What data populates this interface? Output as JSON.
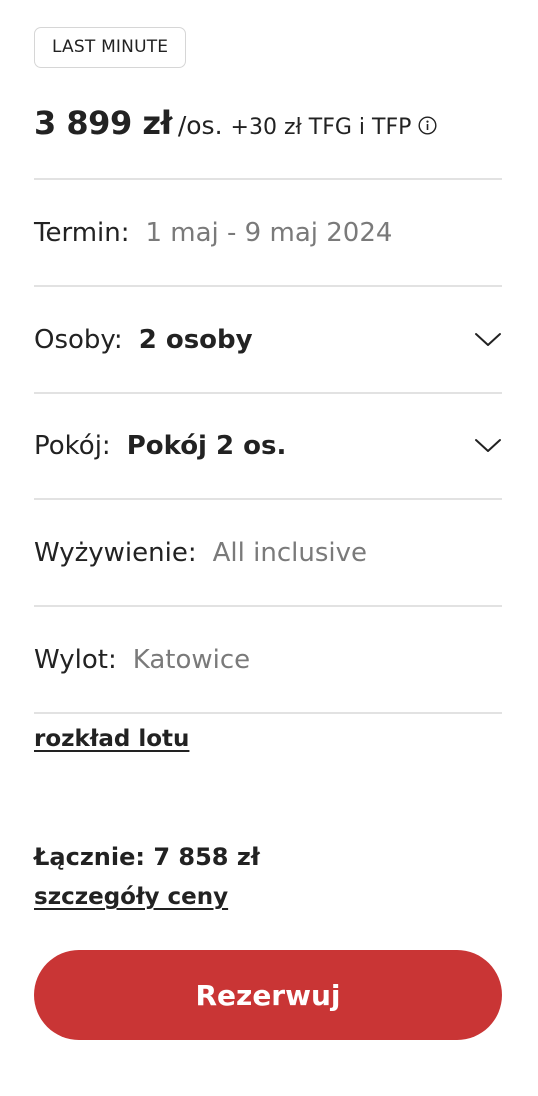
{
  "badge": {
    "text": "LAST MINUTE"
  },
  "price": {
    "amount": "3 899 zł",
    "per": "/os.",
    "extra": "+30 zł TFG i TFP"
  },
  "rows": {
    "termin": {
      "label": "Termin:",
      "value": "1 maj - 9 maj 2024"
    },
    "osoby": {
      "label": "Osoby:",
      "value": "2 osoby"
    },
    "pokoj": {
      "label": "Pokój:",
      "value": "Pokój 2 os."
    },
    "wyzywienie": {
      "label": "Wyżywienie:",
      "value": "All inclusive"
    },
    "wylot": {
      "label": "Wylot:",
      "value": "Katowice"
    }
  },
  "links": {
    "flight_schedule": "rozkład lotu",
    "price_details": "szczegóły ceny"
  },
  "total": {
    "text": "Łącznie: 7 858 zł"
  },
  "cta": {
    "label": "Rezerwuj"
  },
  "icons": {
    "info": "info-circle-icon",
    "dropdown": "chevron-down-icon"
  },
  "colors": {
    "accent": "#c93535",
    "text": "#222222",
    "muted": "#7a7a7a",
    "divider": "#e2e2e2"
  }
}
